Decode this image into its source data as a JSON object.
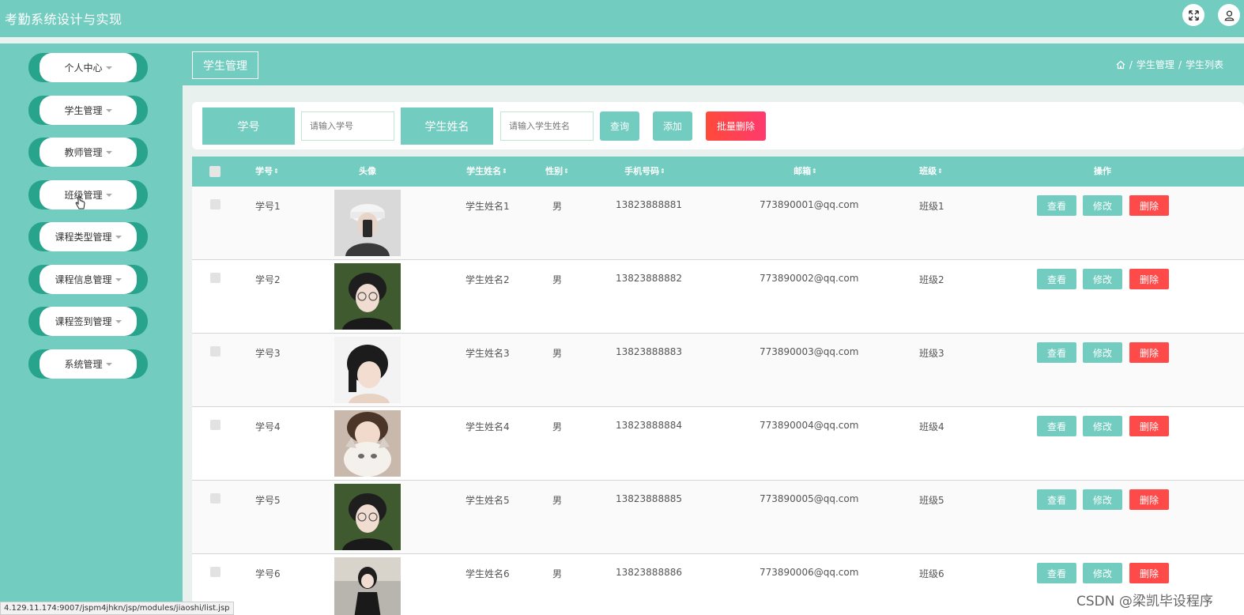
{
  "app": {
    "title": "考勤系统设计与实现"
  },
  "header_icons": {
    "fullscreen": "expand-icon",
    "user": "user-icon"
  },
  "sidebar": {
    "items": [
      {
        "label": "个人中心"
      },
      {
        "label": "学生管理"
      },
      {
        "label": "教师管理"
      },
      {
        "label": "班级管理"
      },
      {
        "label": "课程类型管理"
      },
      {
        "label": "课程信息管理"
      },
      {
        "label": "课程签到管理"
      },
      {
        "label": "系统管理"
      }
    ]
  },
  "page": {
    "tab": "学生管理",
    "breadcrumb": {
      "sep": "/",
      "level1": "学生管理",
      "level2": "学生列表"
    }
  },
  "search": {
    "id_label": "学号",
    "id_placeholder": "请输入学号",
    "name_label": "学生姓名",
    "name_placeholder": "请输入学生姓名",
    "query_button": "查询",
    "add_button": "添加",
    "batch_delete_button": "批量删除"
  },
  "table": {
    "columns": {
      "id": "学号",
      "avatar": "头像",
      "name": "学生姓名",
      "gender": "性别",
      "phone": "手机号码",
      "email": "邮箱",
      "class": "班级",
      "ops": "操作"
    },
    "rows": [
      {
        "id": "学号1",
        "name": "学生姓名1",
        "gender": "男",
        "phone": "13823888881",
        "email": "773890001@qq.com",
        "class": "班级1"
      },
      {
        "id": "学号2",
        "name": "学生姓名2",
        "gender": "男",
        "phone": "13823888882",
        "email": "773890002@qq.com",
        "class": "班级2"
      },
      {
        "id": "学号3",
        "name": "学生姓名3",
        "gender": "男",
        "phone": "13823888883",
        "email": "773890003@qq.com",
        "class": "班级3"
      },
      {
        "id": "学号4",
        "name": "学生姓名4",
        "gender": "男",
        "phone": "13823888884",
        "email": "773890004@qq.com",
        "class": "班级4"
      },
      {
        "id": "学号5",
        "name": "学生姓名5",
        "gender": "男",
        "phone": "13823888885",
        "email": "773890005@qq.com",
        "class": "班级5"
      },
      {
        "id": "学号6",
        "name": "学生姓名6",
        "gender": "男",
        "phone": "13823888886",
        "email": "773890006@qq.com",
        "class": "班级6"
      }
    ],
    "actions": {
      "view": "查看",
      "edit": "修改",
      "delete": "删除"
    }
  },
  "statusbar": {
    "url": "4.129.11.174:9007/jspm4jhkn/jsp/modules/jiaoshi/list.jsp"
  },
  "watermark": {
    "text": "CSDN @梁凯毕设程序"
  },
  "colors": {
    "primary": "#72cdc0",
    "danger": "#ff4a4a",
    "sidebar_accent": "#27a48b"
  }
}
